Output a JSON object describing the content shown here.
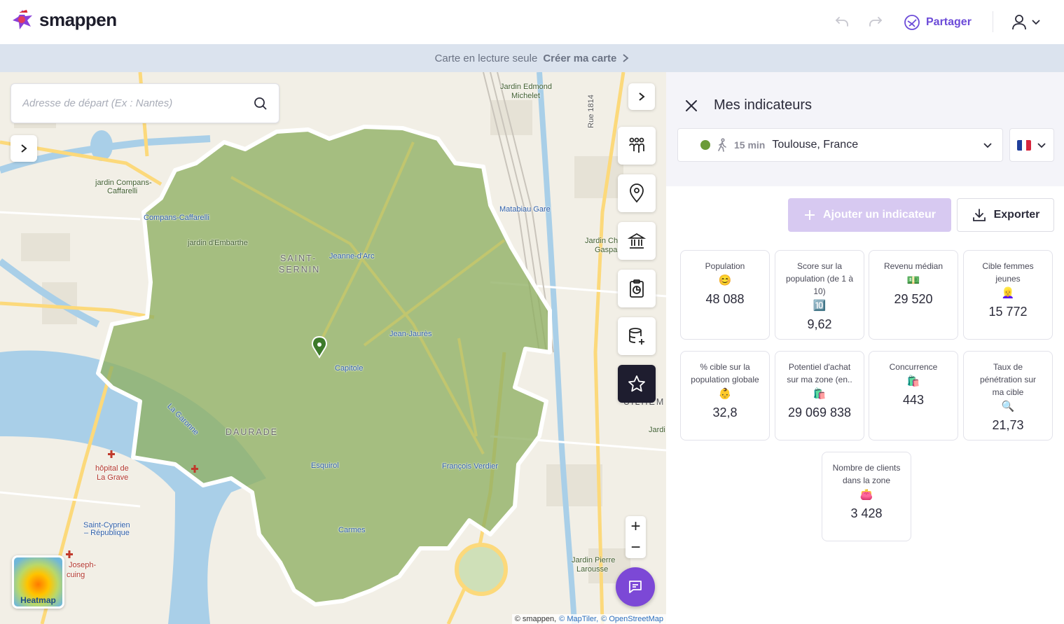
{
  "app": {
    "name": "smappen"
  },
  "header": {
    "share_label": "Partager"
  },
  "banner": {
    "text": "Carte en lecture seule",
    "cta": "Créer ma carte"
  },
  "search": {
    "placeholder": "Adresse de départ (Ex : Nantes)"
  },
  "map": {
    "labels": {
      "jardin_compans": "jardin Compans-",
      "jardin_compans2": "Caffarelli",
      "compans": "Compans-Caffarelli",
      "jardin_embarthe": "jardin d'Embarthe",
      "saint": "SAINT-",
      "sernin": "SERNIN",
      "jeanne": "Jeanne-d'Arc",
      "jardin_edmond": "Jardin Edmond",
      "michelet": "Michelet",
      "matabiau": "Matabiau Gare",
      "jean_jaures": "Jean-Jaurès",
      "capitole": "Capitole",
      "daurade": "DAURADE",
      "garonne": "La Garonne",
      "esquirol": "Esquirol",
      "francois": "François Verdier",
      "carmes": "Carmes",
      "hopital": "hôpital de",
      "lagrave": "La Grave",
      "saint_cyprien": "Saint-Cyprien",
      "republique": "– République",
      "jardin_pierre": "Jardin Pierre",
      "larousse": "Larousse",
      "joseph": "Joseph-",
      "ducuing": "cuing",
      "rue1814": "Rue 1814",
      "jardin_cha": "Jardin Cha",
      "gaspa": "Gaspar",
      "jardi": "Jardi",
      "guilhem": "UILHEM"
    },
    "heatmap_label": "Heatmap",
    "attribution": {
      "smappen": "© smappen,",
      "maptiler": "© MapTiler,",
      "osm": "© OpenStreetMap"
    }
  },
  "panel": {
    "title": "Mes indicateurs",
    "zone": {
      "minutes": "15 min",
      "name": "Toulouse, France",
      "color": "#6b9b38"
    },
    "add_label": "Ajouter un indicateur",
    "export_label": "Exporter",
    "cards": [
      {
        "label": "Population",
        "icon": "😊",
        "value": "48 088"
      },
      {
        "label": "Score sur la population (de 1 à 10)",
        "icon": "🔟",
        "value": "9,62"
      },
      {
        "label": "Revenu médian",
        "icon": "💵",
        "value": "29 520"
      },
      {
        "label": "Cible femmes jeunes",
        "icon": "👱‍♀️",
        "value": "15 772"
      },
      {
        "label": "% cible sur la population globale",
        "icon": "👶",
        "value": "32,8"
      },
      {
        "label": "Potentiel d'achat sur ma zone (en..",
        "icon": "🛍️",
        "value": "29 069 838"
      },
      {
        "label": "Concurrence",
        "icon": "🛍️",
        "value": "443"
      },
      {
        "label": "Taux de pénétration sur ma cible",
        "icon": "🔍",
        "value": "21,73"
      },
      {
        "label": "Nombre de clients dans la zone",
        "icon": "👛",
        "value": "3 428"
      }
    ]
  },
  "colors": {
    "accent": "#7c48d6",
    "zone": "#8fb063",
    "water": "#a9cfe8"
  }
}
